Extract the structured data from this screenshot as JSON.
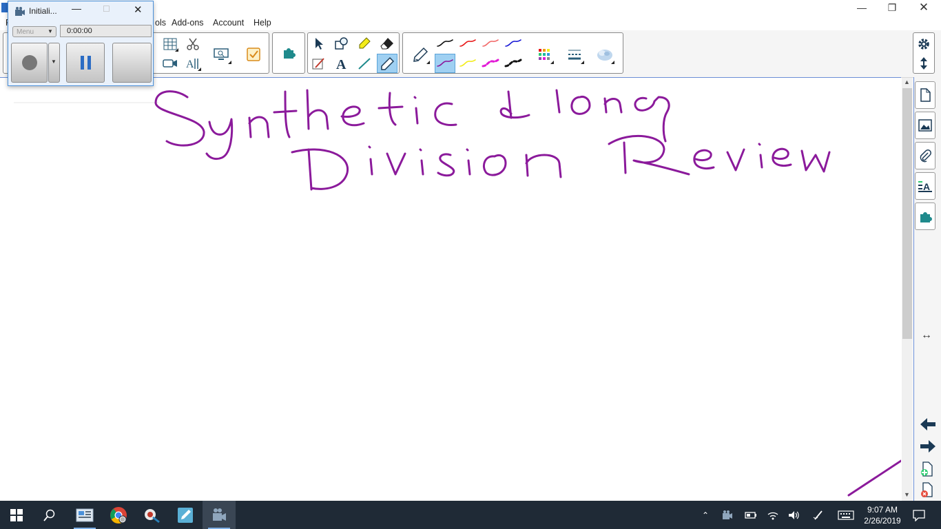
{
  "window": {
    "menu": [
      "Add-ons",
      "Account",
      "Help"
    ],
    "menu_partial": "ols",
    "menu_first": "F"
  },
  "recorder": {
    "title": "Initiali...",
    "menu_label": "Menu",
    "time": "0:00:00"
  },
  "toolbar": {
    "pen_colors": [
      "#111111",
      "#e81818",
      "#f26a6a",
      "#1a1ad6",
      "#8b1a9b",
      "#f3ec1a",
      "#e21ad6",
      "#111111"
    ],
    "selected_pen_color": "#8b1a9b"
  },
  "canvas": {
    "ink_color": "#8b1a9b"
  },
  "taskbar": {
    "time": "9:07 AM",
    "date": "2/26/2019"
  }
}
